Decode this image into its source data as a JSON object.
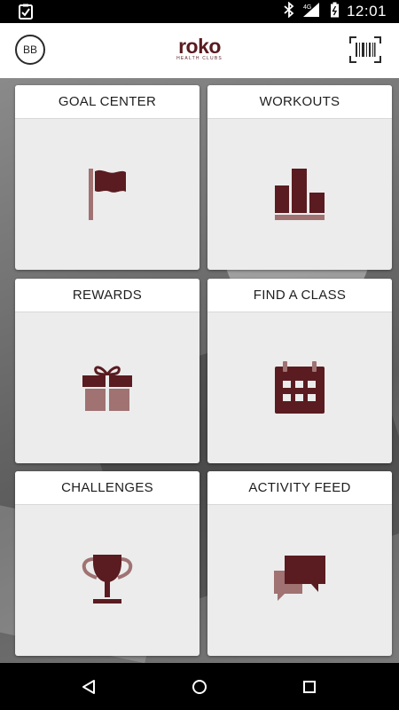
{
  "status_bar": {
    "time": "12:01",
    "network": "4G",
    "icons": [
      "clipboard-check-icon",
      "bluetooth-icon",
      "signal-icon",
      "battery-icon"
    ]
  },
  "app_bar": {
    "avatar_initials": "BB",
    "logo_text": "roko",
    "logo_tagline": "HEALTH CLUBS",
    "barcode_icon": "barcode-scan-icon"
  },
  "tiles": [
    {
      "label": "GOAL CENTER",
      "icon": "flag-icon"
    },
    {
      "label": "WORKOUTS",
      "icon": "bar-chart-icon"
    },
    {
      "label": "REWARDS",
      "icon": "gift-icon"
    },
    {
      "label": "FIND A CLASS",
      "icon": "calendar-icon"
    },
    {
      "label": "CHALLENGES",
      "icon": "trophy-icon"
    },
    {
      "label": "ACTIVITY FEED",
      "icon": "chat-bubbles-icon"
    }
  ],
  "colors": {
    "brand": "#5a1c20",
    "brand_light": "#a07272",
    "tile_bg": "#ececec",
    "tile_header_bg": "#ffffff"
  },
  "nav_bar": {
    "icons": [
      "back-triangle-icon",
      "home-circle-icon",
      "recents-square-icon"
    ]
  }
}
